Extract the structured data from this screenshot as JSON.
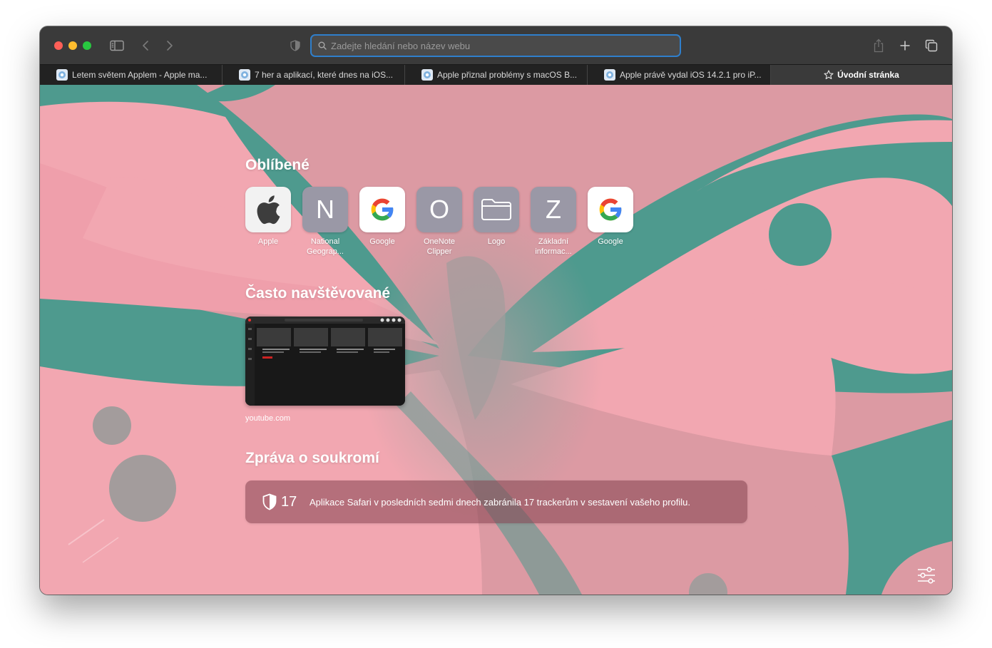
{
  "address_bar": {
    "placeholder": "Zadejte hledání nebo název webu"
  },
  "tabs": [
    {
      "title": "Letem světem Applem - Apple ma..."
    },
    {
      "title": "7 her a aplikací, které dnes na iOS..."
    },
    {
      "title": "Apple přiznal problémy s macOS B..."
    },
    {
      "title": "Apple právě vydal iOS 14.2.1 pro iP..."
    }
  ],
  "active_tab": {
    "title": "Úvodní stránka"
  },
  "favorites": {
    "title": "Oblíbené",
    "items": [
      {
        "label": "Apple",
        "icon": "apple-logo-icon"
      },
      {
        "label": "National Geograp...",
        "letter": "N"
      },
      {
        "label": "Google",
        "icon": "google-logo-icon"
      },
      {
        "label": "OneNote Clipper",
        "letter": "O"
      },
      {
        "label": "Logo",
        "icon": "folder-icon"
      },
      {
        "label": "Základní informac...",
        "letter": "Z"
      },
      {
        "label": "Google",
        "icon": "google-logo-icon"
      }
    ]
  },
  "frequently_visited": {
    "title": "Často navštěvované",
    "items": [
      {
        "label": "youtube.com"
      }
    ]
  },
  "privacy_report": {
    "title": "Zpráva o soukromí",
    "count": "17",
    "message": "Aplikace Safari v posledních sedmi dnech zabránila 17 trackerům v sestavení vašeho profilu."
  },
  "colors": {
    "wallpaper_pink": "#f2a7b1",
    "wallpaper_teal": "#4e9a8e",
    "wallpaper_grey": "#a39c9c",
    "address_focus": "#2f7fcc"
  }
}
